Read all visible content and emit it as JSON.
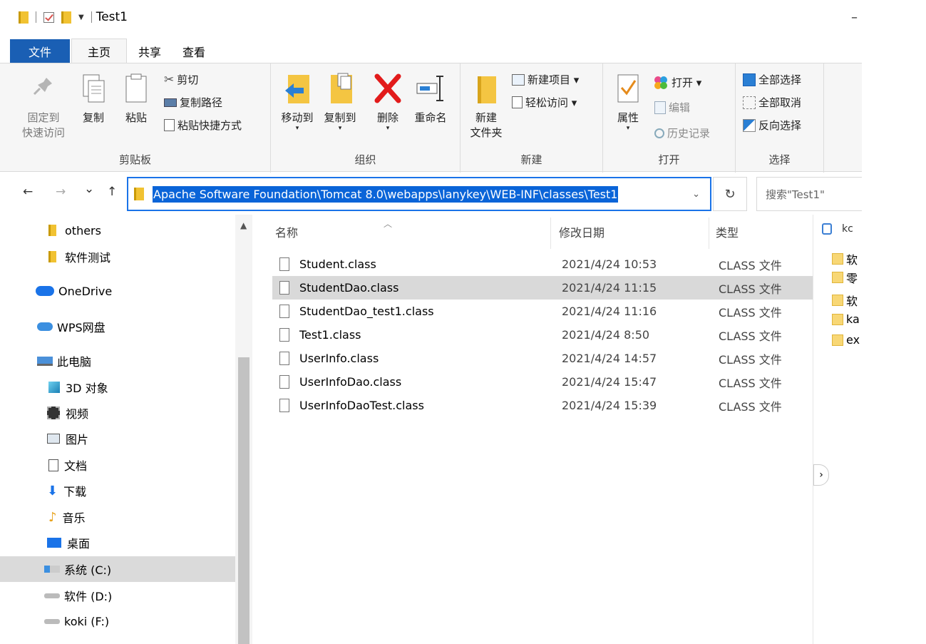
{
  "window": {
    "title": "Test1",
    "minimize_glyph": "–"
  },
  "ribbon_tabs": [
    {
      "label": "文件"
    },
    {
      "label": "主页"
    },
    {
      "label": "共享"
    },
    {
      "label": "查看"
    }
  ],
  "ribbon": {
    "clipboard": {
      "label": "剪贴板",
      "pin_line1": "固定到",
      "pin_line2": "快速访问",
      "copy": "复制",
      "paste": "粘贴",
      "cut": "剪切",
      "copy_path": "复制路径",
      "paste_shortcut": "粘贴快捷方式"
    },
    "organize": {
      "label": "组织",
      "move_to": "移动到",
      "copy_to": "复制到",
      "delete": "删除",
      "rename": "重命名"
    },
    "new": {
      "label": "新建",
      "new_folder_line1": "新建",
      "new_folder_line2": "文件夹",
      "new_item": "新建项目 ▾",
      "easy_access": "轻松访问 ▾"
    },
    "open": {
      "label": "打开",
      "properties": "属性",
      "open": "打开 ▾",
      "edit": "编辑",
      "history": "历史记录"
    },
    "select": {
      "label": "选择",
      "select_all": "全部选择",
      "select_none": "全部取消",
      "invert": "反向选择"
    }
  },
  "nav": {
    "back": "←",
    "forward": "→",
    "recent": "⌄",
    "up": "↑",
    "address_path": "Apache Software Foundation\\Tomcat 8.0\\webapps\\lanykey\\WEB-INF\\classes\\Test1",
    "address_chevron": "⌄",
    "refresh": "↻",
    "search_placeholder": "搜索\"Test1\""
  },
  "sidebar": {
    "items": [
      {
        "label": "others"
      },
      {
        "label": "软件测试"
      },
      {
        "label": "OneDrive"
      },
      {
        "label": "WPS网盘"
      },
      {
        "label": "此电脑"
      },
      {
        "label": "3D 对象"
      },
      {
        "label": "视频"
      },
      {
        "label": "图片"
      },
      {
        "label": "文档"
      },
      {
        "label": "下载"
      },
      {
        "label": "音乐"
      },
      {
        "label": "桌面"
      },
      {
        "label": "系统 (C:)"
      },
      {
        "label": "软件 (D:)"
      },
      {
        "label": "koki (F:)"
      }
    ]
  },
  "filelist": {
    "columns": {
      "name": "名称",
      "date": "修改日期",
      "type": "类型"
    },
    "rows": [
      {
        "name": "Student.class",
        "date": "2021/4/24 10:53",
        "type": "CLASS 文件"
      },
      {
        "name": "StudentDao.class",
        "date": "2021/4/24 11:15",
        "type": "CLASS 文件"
      },
      {
        "name": "StudentDao_test1.class",
        "date": "2021/4/24 11:16",
        "type": "CLASS 文件"
      },
      {
        "name": "Test1.class",
        "date": "2021/4/24 8:50",
        "type": "CLASS 文件"
      },
      {
        "name": "UserInfo.class",
        "date": "2021/4/24 14:57",
        "type": "CLASS 文件"
      },
      {
        "name": "UserInfoDao.class",
        "date": "2021/4/24 15:47",
        "type": "CLASS 文件"
      },
      {
        "name": "UserInfoDaoTest.class",
        "date": "2021/4/24 15:39",
        "type": "CLASS 文件"
      }
    ]
  },
  "preview": {
    "header": "kc",
    "items": [
      {
        "label": "软"
      },
      {
        "label": "零"
      },
      {
        "label": "软"
      },
      {
        "label": "ka"
      },
      {
        "label": "ex"
      }
    ],
    "expand_glyph": "›"
  }
}
